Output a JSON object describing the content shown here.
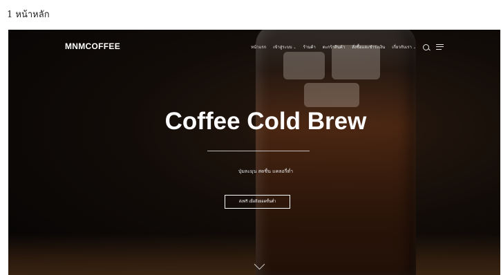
{
  "caption": "1 หน้าหลัก",
  "site": {
    "logo": "MNMCOFFEE",
    "nav": [
      {
        "label": "หน้าแรก",
        "dropdown": false
      },
      {
        "label": "เข้าสู่ระบบ",
        "dropdown": true
      },
      {
        "label": "ร้านค้า",
        "dropdown": false
      },
      {
        "label": "ตะกร้าสินค้า",
        "dropdown": false
      },
      {
        "label": "สั่งซื้อและชำระเงิน",
        "dropdown": false
      },
      {
        "label": "เกี่ยวกับเรา",
        "dropdown": true
      }
    ],
    "icons": [
      "search-icon",
      "menu-icon"
    ]
  },
  "hero": {
    "title": "Coffee Cold Brew",
    "subtitle": "ปุ่มละมุน สดชื่น แคลอรี่ต่ำ",
    "button": "ส่งฟรี เมื่อถึงยอดขั้นต่ำ"
  },
  "colors": {
    "text": "#ffffff",
    "background": "#0b0806",
    "accent": "#5a3418"
  }
}
